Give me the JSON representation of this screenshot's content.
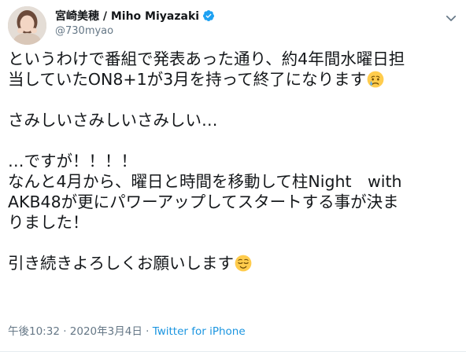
{
  "user": {
    "display_name": "宮崎美穂 / Miho Miyazaki",
    "handle": "@730myao",
    "verified": true
  },
  "tweet": {
    "lines": [
      "というわけで番組で発表あった通り、約4年間水曜日担",
      "当していたON8+1が3月を持って終了になります",
      "",
      "さみしいさみしいさみしい…",
      "",
      "…ですが！！！！",
      "なんと4月から、曜日と時間を移動して柱Night　with",
      "AKB48が更にパワーアップしてスタートする事が決ま",
      "りました！",
      "",
      "引き続きよろしくお願いします"
    ],
    "emojis": {
      "line2": "crying-face",
      "line11": "relieved-face"
    }
  },
  "meta": {
    "time": "午後10:32",
    "separator": " · ",
    "date": "2020年3月4日",
    "source": "Twitter for iPhone"
  },
  "colors": {
    "primary_text": "#14171a",
    "secondary_text": "#657786",
    "link": "#1b95e0",
    "verified": "#1da1f2"
  }
}
